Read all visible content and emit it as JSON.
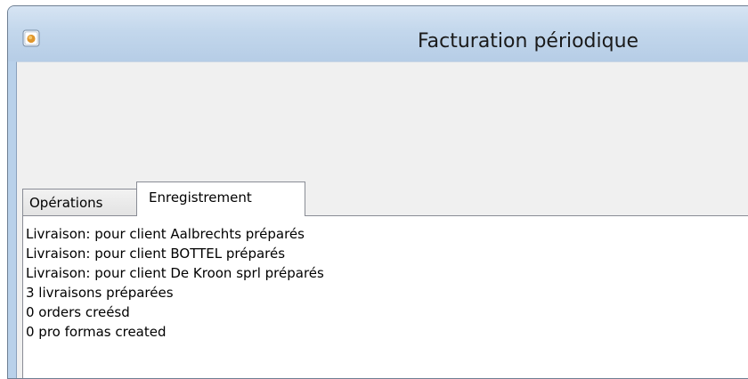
{
  "window": {
    "title": "Facturation périodique",
    "icon": "app-icon"
  },
  "tabs": [
    {
      "label": "Opérations",
      "active": false
    },
    {
      "label": "Enregistrement",
      "active": true
    }
  ],
  "log": {
    "lines": [
      "Livraison:  pour client Aalbrechts préparés",
      "Livraison:  pour client BOTTEL préparés",
      "Livraison:  pour client De Kroon sprl préparés",
      "3 livraisons préparées",
      "0 orders creésd",
      "0 pro formas created"
    ]
  },
  "colors": {
    "frame": "#b9d1ea",
    "client": "#f0f0f0",
    "panel": "#ffffff"
  }
}
